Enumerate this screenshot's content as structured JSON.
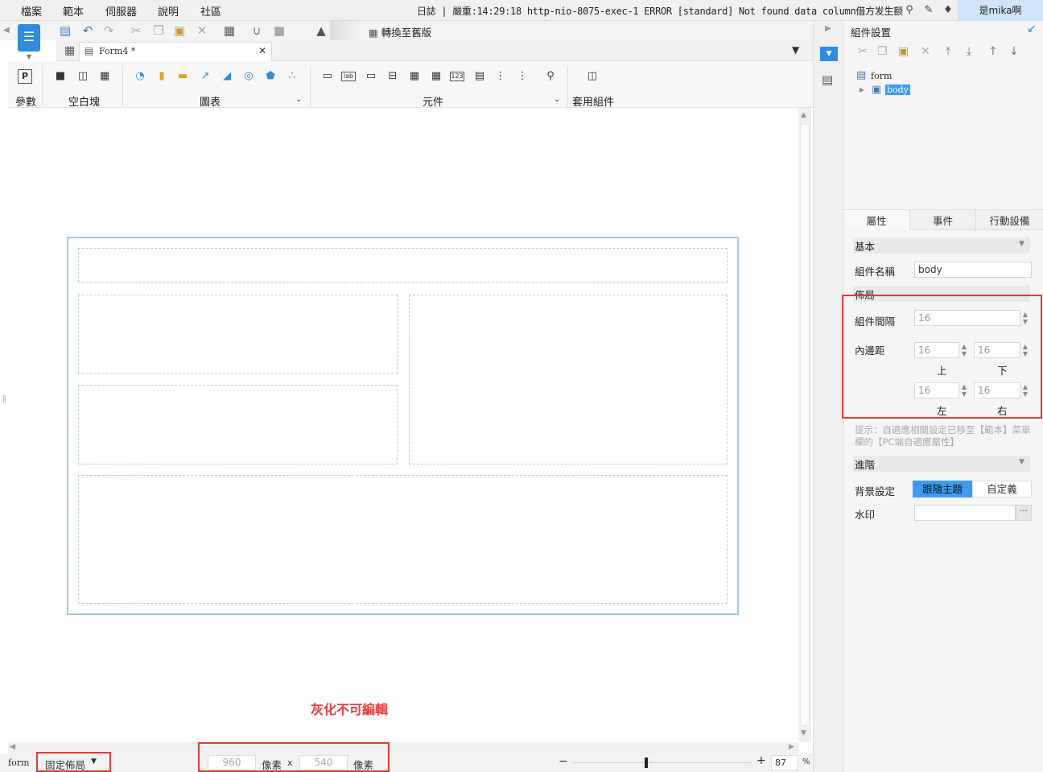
{
  "menu": {
    "items": [
      "檔案",
      "範本",
      "伺服器",
      "說明",
      "社區"
    ],
    "log": "日誌 | 嚴重:14:29:18 http-nio-8075-exec-1 ERROR [standard] Not found data column借方发生额",
    "user": "是mika啊"
  },
  "toolbar": {
    "convert_label": "轉換至舊版"
  },
  "tab": {
    "name": "Form4 *"
  },
  "ribbon": {
    "param": "參數",
    "blank": "空白塊",
    "chart": "圖表",
    "widget": "元件",
    "apply": "套用組件",
    "lab": "lab",
    "num": "123"
  },
  "canvas": {
    "note": "灰化不可編輯"
  },
  "status": {
    "form": "form",
    "layout": "固定佈局",
    "width": "960",
    "height": "540",
    "unit": "像素",
    "x": "x",
    "zoom": "87",
    "percent": "%"
  },
  "panel": {
    "title": "組件設置",
    "tree_form": "form",
    "tree_body": "body",
    "tabs": [
      "屬性",
      "事件",
      "行動設備"
    ],
    "basic": "基本",
    "name_label": "組件名稱",
    "name_value": "body",
    "layout": "佈局",
    "gap_label": "組件間隔",
    "gap": "16",
    "padding_label": "內邊距",
    "pad_top": "16",
    "pad_bottom": "16",
    "pad_left": "16",
    "pad_right": "16",
    "top": "上",
    "bottom": "下",
    "left": "左",
    "right": "右",
    "hint": "提示：自適應相關設定已移至【範本】菜單欄的【PC端自適應屬性】",
    "advanced": "進階",
    "bg_label": "背景設定",
    "bg_theme": "跟隨主題",
    "bg_custom": "自定義",
    "watermark_label": "水印",
    "dots": "···"
  },
  "colors": {
    "accent": "#2d8be0",
    "selection": "#3c9cf2",
    "red": "#e53935"
  }
}
